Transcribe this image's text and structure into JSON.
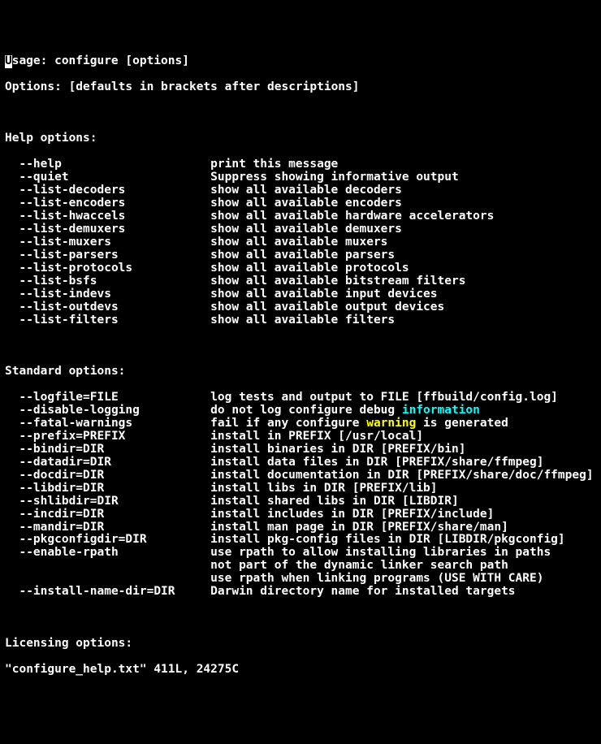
{
  "usage_char": "U",
  "usage_rest": "sage: configure [options]",
  "options_line": "Options: [defaults in brackets after descriptions]",
  "help_header": "Help options:",
  "help_options": [
    {
      "flag": "--help",
      "desc": "print this message"
    },
    {
      "flag": "--quiet",
      "desc": "Suppress showing informative output"
    },
    {
      "flag": "--list-decoders",
      "desc": "show all available decoders"
    },
    {
      "flag": "--list-encoders",
      "desc": "show all available encoders"
    },
    {
      "flag": "--list-hwaccels",
      "desc": "show all available hardware accelerators"
    },
    {
      "flag": "--list-demuxers",
      "desc": "show all available demuxers"
    },
    {
      "flag": "--list-muxers",
      "desc": "show all available muxers"
    },
    {
      "flag": "--list-parsers",
      "desc": "show all available parsers"
    },
    {
      "flag": "--list-protocols",
      "desc": "show all available protocols"
    },
    {
      "flag": "--list-bsfs",
      "desc": "show all available bitstream filters"
    },
    {
      "flag": "--list-indevs",
      "desc": "show all available input devices"
    },
    {
      "flag": "--list-outdevs",
      "desc": "show all available output devices"
    },
    {
      "flag": "--list-filters",
      "desc": "show all available filters"
    }
  ],
  "standard_header": "Standard options:",
  "standard_options": [
    {
      "flag": "--logfile=FILE",
      "desc": [
        {
          "t": "log tests and output to FILE [ffbuild/config.log]"
        }
      ]
    },
    {
      "flag": "--disable-logging",
      "desc": [
        {
          "t": "do not log configure debug "
        },
        {
          "t": "information",
          "c": "cyan"
        }
      ]
    },
    {
      "flag": "--fatal-warnings",
      "desc": [
        {
          "t": "fail if any configure "
        },
        {
          "t": "warning",
          "c": "yellow"
        },
        {
          "t": " is generated"
        }
      ]
    },
    {
      "flag": "--prefix=PREFIX",
      "desc": [
        {
          "t": "install in PREFIX [/usr/local]"
        }
      ]
    },
    {
      "flag": "--bindir=DIR",
      "desc": [
        {
          "t": "install binaries in DIR [PREFIX/bin]"
        }
      ]
    },
    {
      "flag": "--datadir=DIR",
      "desc": [
        {
          "t": "install data files in DIR [PREFIX/share/ffmpeg]"
        }
      ]
    },
    {
      "flag": "--docdir=DIR",
      "desc": [
        {
          "t": "install documentation in DIR [PREFIX/share/doc/ffmpeg]"
        }
      ]
    },
    {
      "flag": "--libdir=DIR",
      "desc": [
        {
          "t": "install libs in DIR [PREFIX/lib]"
        }
      ]
    },
    {
      "flag": "--shlibdir=DIR",
      "desc": [
        {
          "t": "install shared libs in DIR [LIBDIR]"
        }
      ]
    },
    {
      "flag": "--incdir=DIR",
      "desc": [
        {
          "t": "install includes in DIR [PREFIX/include]"
        }
      ]
    },
    {
      "flag": "--mandir=DIR",
      "desc": [
        {
          "t": "install man page in DIR [PREFIX/share/man]"
        }
      ]
    },
    {
      "flag": "--pkgconfigdir=DIR",
      "desc": [
        {
          "t": "install pkg-config files in DIR [LIBDIR/pkgconfig]"
        }
      ]
    },
    {
      "flag": "--enable-rpath",
      "desc": [
        {
          "t": "use rpath to allow installing libraries in paths"
        }
      ]
    },
    {
      "flag": "",
      "desc": [
        {
          "t": "not part of the dynamic linker search path"
        }
      ]
    },
    {
      "flag": "",
      "desc": [
        {
          "t": "use rpath when linking programs (USE WITH CARE)"
        }
      ]
    },
    {
      "flag": "--install-name-dir=DIR",
      "desc": [
        {
          "t": "Darwin directory name for installed targets"
        }
      ]
    }
  ],
  "licensing_header": "Licensing options:",
  "status_line": "\"configure_help.txt\" 411L, 24275C"
}
